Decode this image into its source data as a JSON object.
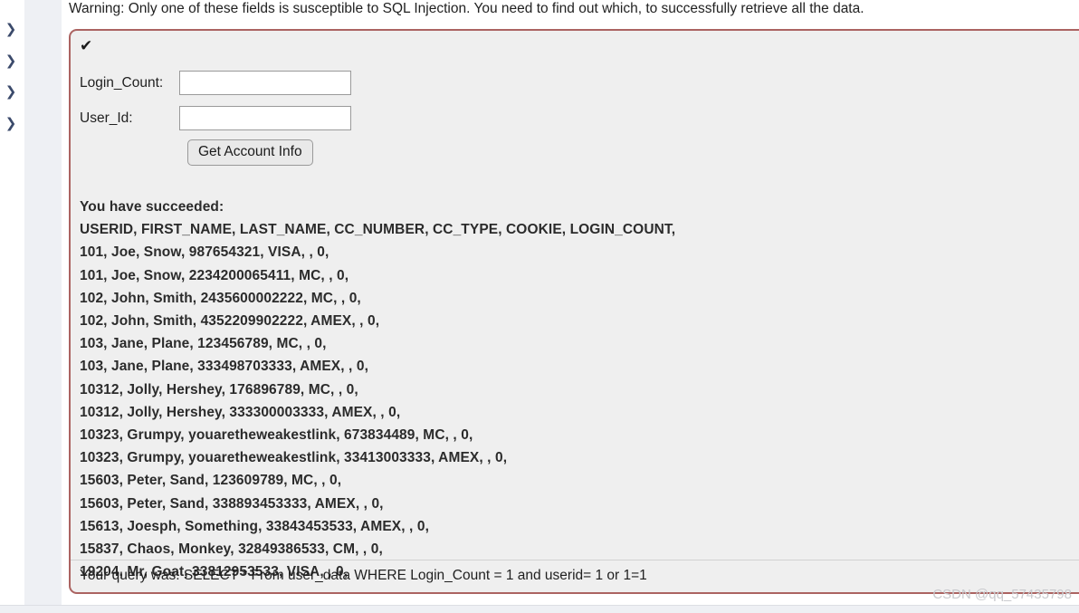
{
  "colors": {
    "panel_border": "#ab6361",
    "panel_background": "#efefef",
    "page_background": "#ffffff",
    "rail_background": "#eef0f4",
    "result_text": "#2b2b2b",
    "watermark": "#c8c9cd"
  },
  "sidebar": {
    "toggles": [
      {
        "icon": "chevron-right-icon",
        "glyph": "❯"
      },
      {
        "icon": "chevron-right-icon",
        "glyph": "❯"
      },
      {
        "icon": "chevron-right-icon",
        "glyph": "❯"
      },
      {
        "icon": "chevron-right-icon",
        "glyph": "❯"
      }
    ]
  },
  "warning": {
    "text": "Warning: Only one of these fields is susceptible to SQL Injection. You need to find out which, to successfully retrieve all the data."
  },
  "panel": {
    "status_icon": "check-mark-icon",
    "status_glyph": "✔"
  },
  "form": {
    "fields": [
      {
        "label": "Login_Count:",
        "value": "",
        "placeholder": "",
        "name": "login-count-input"
      },
      {
        "label": "User_Id:",
        "value": "",
        "placeholder": "",
        "name": "user-id-input"
      }
    ],
    "submit_label": "Get Account Info"
  },
  "results": {
    "success_message": "You have succeeded:",
    "header": "USERID, FIRST_NAME, LAST_NAME, CC_NUMBER, CC_TYPE, COOKIE, LOGIN_COUNT,",
    "rows": [
      "101, Joe, Snow, 987654321, VISA, , 0,",
      "101, Joe, Snow, 2234200065411, MC, , 0,",
      "102, John, Smith, 2435600002222, MC, , 0,",
      "102, John, Smith, 4352209902222, AMEX, , 0,",
      "103, Jane, Plane, 123456789, MC, , 0,",
      "103, Jane, Plane, 333498703333, AMEX, , 0,",
      "10312, Jolly, Hershey, 176896789, MC, , 0,",
      "10312, Jolly, Hershey, 333300003333, AMEX, , 0,",
      "10323, Grumpy, youaretheweakestlink, 673834489, MC, , 0,",
      "10323, Grumpy, youaretheweakestlink, 33413003333, AMEX, , 0,",
      "15603, Peter, Sand, 123609789, MC, , 0,",
      "15603, Peter, Sand, 338893453333, AMEX, , 0,",
      "15613, Joesph, Something, 33843453533, AMEX, , 0,",
      "15837, Chaos, Monkey, 32849386533, CM, , 0,",
      "19204, Mr, Goat, 33812953533, VISA, , 0,"
    ]
  },
  "query": {
    "text": "Your query was: SELECT * From user_data WHERE Login_Count = 1 and userid= 1 or 1=1"
  },
  "watermark": {
    "text": "CSDN @qq_57435798"
  }
}
